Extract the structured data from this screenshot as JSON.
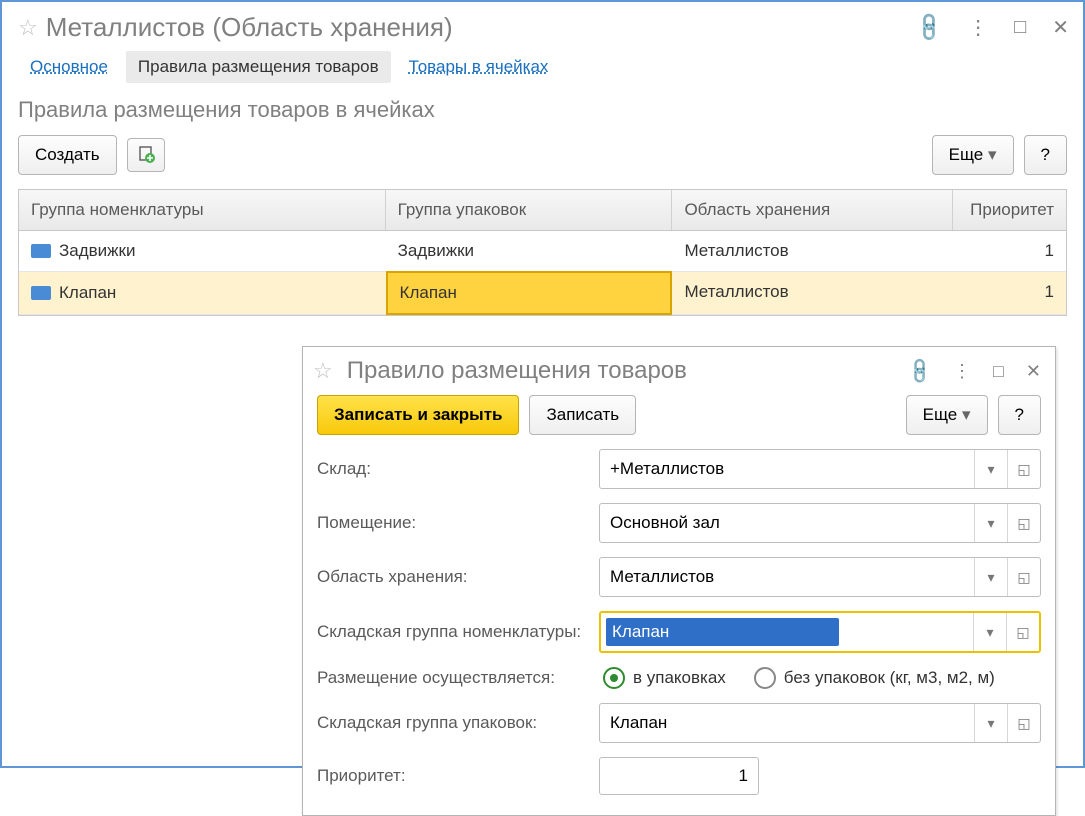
{
  "header": {
    "title": "Металлистов (Область хранения)"
  },
  "tabs": {
    "main": "Основное",
    "rules": "Правила размещения товаров",
    "goods": "Товары в ячейках"
  },
  "subtitle": "Правила размещения товаров в ячейках",
  "toolbar": {
    "create": "Создать",
    "more": "Еще",
    "help": "?"
  },
  "table": {
    "headers": {
      "c1": "Группа номенклатуры",
      "c2": "Группа упаковок",
      "c3": "Область хранения",
      "c4": "Приоритет"
    },
    "rows": [
      {
        "c1": "Задвижки",
        "c2": "Задвижки",
        "c3": "Металлистов",
        "c4": "1"
      },
      {
        "c1": "Клапан",
        "c2": "Клапан",
        "c3": "Металлистов",
        "c4": "1"
      }
    ]
  },
  "dialog": {
    "title": "Правило размещения товаров",
    "save_close": "Записать и закрыть",
    "save": "Записать",
    "more": "Еще",
    "help": "?",
    "labels": {
      "warehouse": "Склад:",
      "room": "Помещение:",
      "area": "Область хранения:",
      "nomgroup": "Складская группа номенклатуры:",
      "placement": "Размещение осуществляется:",
      "packgroup": "Складская группа упаковок:",
      "priority": "Приоритет:"
    },
    "values": {
      "warehouse": "+Металлистов",
      "room": "Основной зал",
      "area": "Металлистов",
      "nomgroup": "Клапан",
      "packgroup": "Клапан",
      "priority": "1"
    },
    "radios": {
      "packed": "в упаковках",
      "loose": "без упаковок (кг, м3, м2, м)"
    }
  }
}
